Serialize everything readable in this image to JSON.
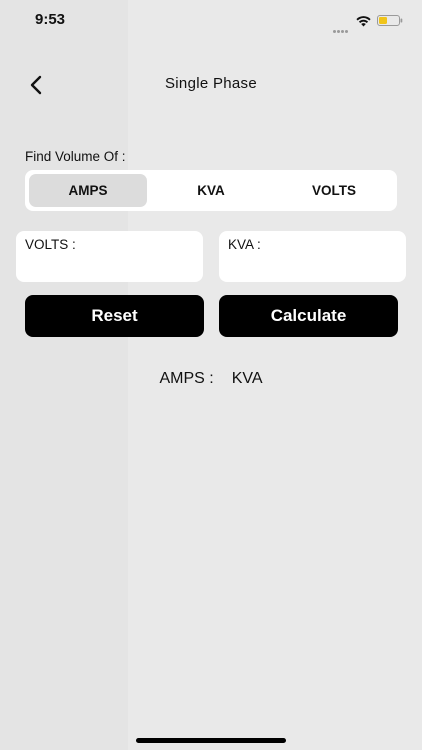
{
  "status_bar": {
    "time": "9:53",
    "icons": [
      "signal-dots-icon",
      "wifi-icon",
      "battery-icon"
    ],
    "battery_color": "#f0c419"
  },
  "header": {
    "back_icon": "chevron-left-icon",
    "title": "Single Phase"
  },
  "find": {
    "label": "Find Volume Of :"
  },
  "segments": [
    {
      "label": "AMPS",
      "active": true
    },
    {
      "label": "KVA",
      "active": false
    },
    {
      "label": "VOLTS",
      "active": false
    }
  ],
  "fields": [
    {
      "label": "VOLTS :",
      "value": ""
    },
    {
      "label": "KVA :",
      "value": ""
    }
  ],
  "buttons": {
    "reset_label": "Reset",
    "calculate_label": "Calculate"
  },
  "result": {
    "label": "AMPS :",
    "value": "KVA"
  },
  "colors": {
    "background": "#e6e6e6",
    "button_bg": "#000000",
    "active_segment": "#dcdcdc"
  }
}
